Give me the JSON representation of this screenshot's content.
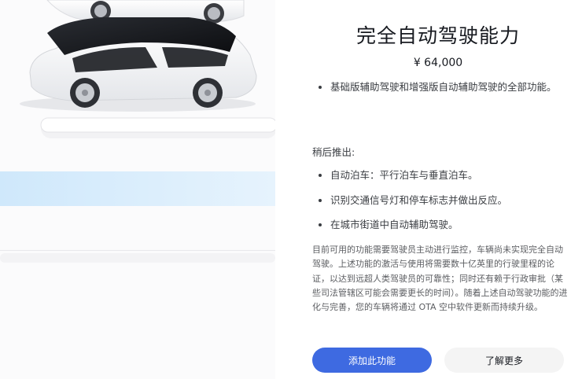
{
  "feature": {
    "title": "完全自动驾驶能力",
    "price": "¥ 64,000",
    "included": [
      "基础版辅助驾驶和增强版自动辅助驾驶的全部功能。"
    ],
    "later_label": "稍后推出:",
    "later_items": [
      "自动泊车：平行泊车与垂直泊车。",
      "识别交通信号灯和停车标志并做出反应。",
      "在城市街道中自动辅助驾驶。"
    ],
    "disclaimer": "目前可用的功能需要驾驶员主动进行监控，车辆尚未实现完全自动驾驶。上述功能的激活与使用将需要数十亿英里的行驶里程的论证，以达到远超人类驾驶员的可靠性；同时还有赖于行政审批（某些司法管辖区可能会需要更长的时间）。随着上述自动驾驶功能的进化与完善，您的车辆将通过 OTA 空中软件更新而持续升级。"
  },
  "actions": {
    "add_label": "添加此功能",
    "learn_label": "了解更多"
  },
  "colors": {
    "accent": "#3e6ae1",
    "secondary_bg": "#f4f4f4",
    "title": "#171a20"
  }
}
